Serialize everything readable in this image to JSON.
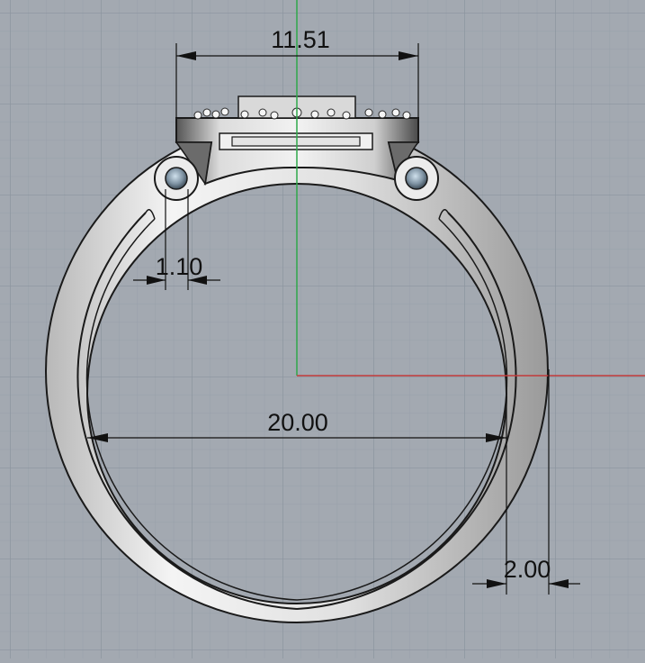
{
  "viewport": {
    "background_color": "#a3a9b1",
    "grid_minor_color": "#97a0aa",
    "grid_major_color": "#8a939e",
    "x_axis_color": "#c23a3a",
    "y_axis_color": "#2fa84a"
  },
  "dimensions": {
    "head_width": "11.51",
    "pin_offset": "1.10",
    "inner_diameter": "20.00",
    "band_thickness": "2.00"
  },
  "model": {
    "object": "ring",
    "metal_color": "#e6e6e6",
    "shadow_color": "#5a5a5a",
    "pin_color": "#7f93a3"
  }
}
